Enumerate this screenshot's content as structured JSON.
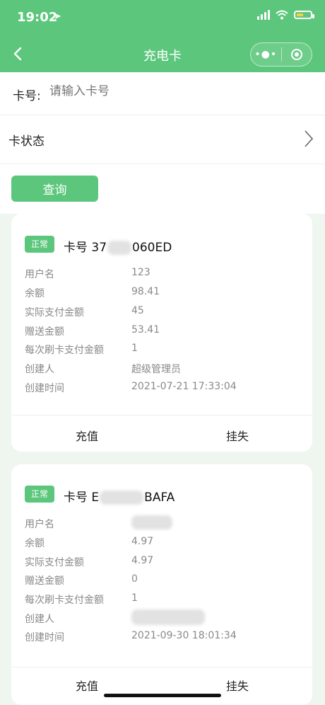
{
  "status": {
    "time": "19:02"
  },
  "nav": {
    "title": "充电卡"
  },
  "form": {
    "card_label": "卡号:",
    "card_placeholder": "请输入卡号",
    "status_label": "卡状态",
    "query_label": "查询"
  },
  "cards": [
    {
      "badge": "正常",
      "card_prefix": "卡号 37",
      "card_suffix": "060ED",
      "fields": [
        {
          "key": "用户名",
          "value": "123"
        },
        {
          "key": "余额",
          "value": "98.41"
        },
        {
          "key": "实际支付金额",
          "value": "45"
        },
        {
          "key": "赠送金额",
          "value": "53.41"
        },
        {
          "key": "每次刷卡支付金额",
          "value": "1"
        },
        {
          "key": "创建人",
          "value": "超级管理员"
        },
        {
          "key": "创建时间",
          "value": "2021-07-21 17:33:04"
        }
      ],
      "actions": [
        "充值",
        "挂失"
      ]
    },
    {
      "badge": "正常",
      "card_prefix": "卡号 E",
      "card_suffix": "BAFA",
      "fields": [
        {
          "key": "用户名",
          "value": ""
        },
        {
          "key": "余额",
          "value": "4.97"
        },
        {
          "key": "实际支付金额",
          "value": "4.97"
        },
        {
          "key": "赠送金额",
          "value": "0"
        },
        {
          "key": "每次刷卡支付金额",
          "value": "1"
        },
        {
          "key": "创建人",
          "value": ""
        },
        {
          "key": "创建时间",
          "value": "2021-09-30 18:01:34"
        }
      ],
      "actions": [
        "充值",
        "挂失"
      ]
    }
  ]
}
